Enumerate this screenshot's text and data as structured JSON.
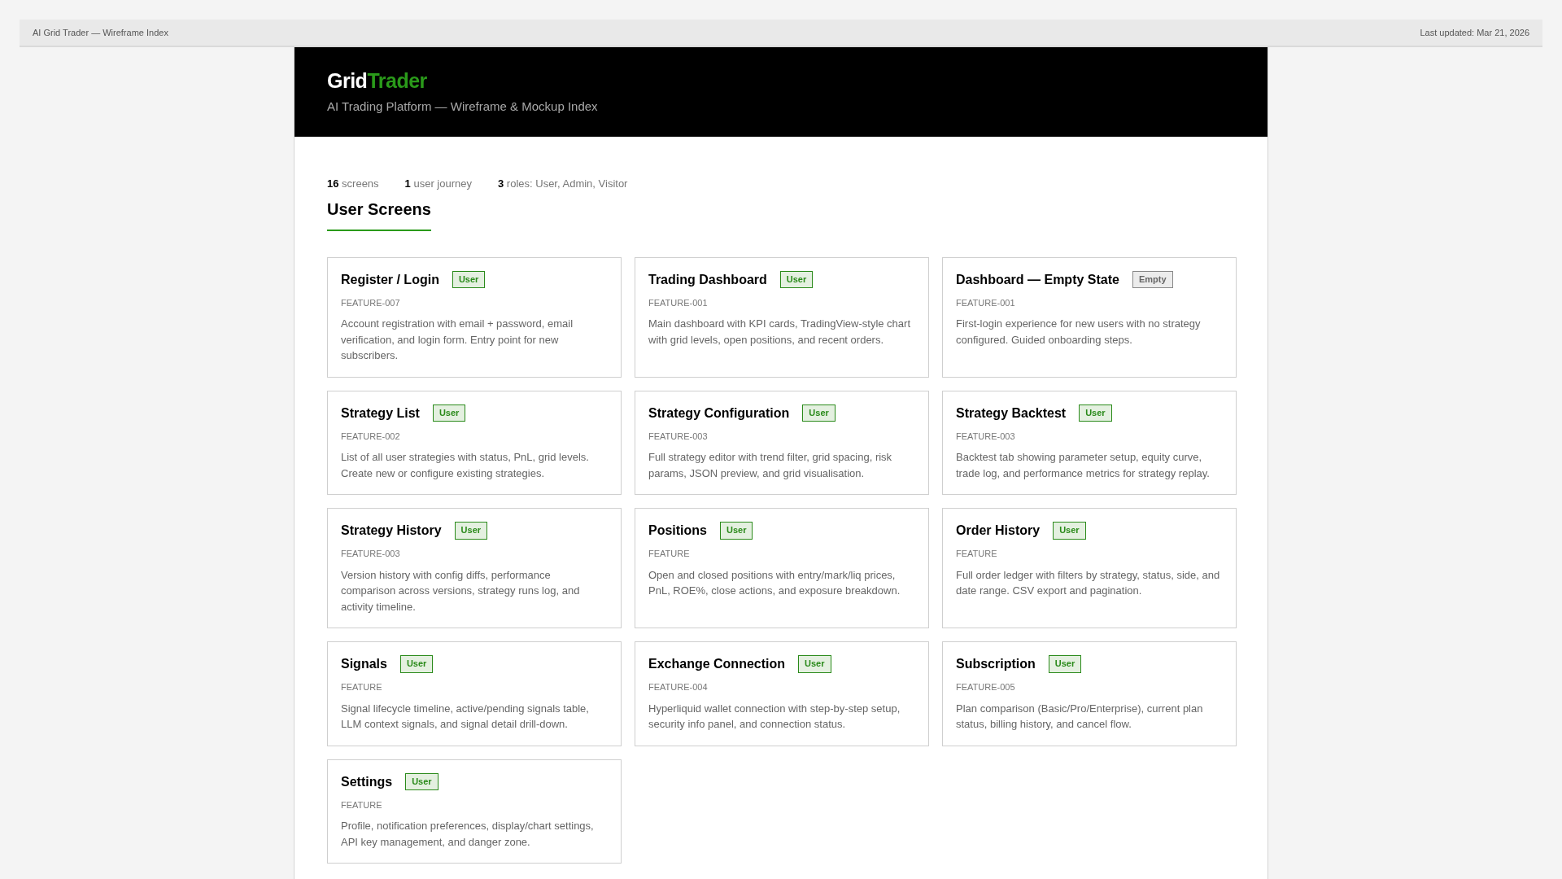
{
  "top_bar": {
    "title": "AI Grid Trader — Wireframe Index",
    "updated": "Last updated: Mar 21, 2026"
  },
  "header": {
    "logo_primary": "Grid",
    "logo_accent": "Trader",
    "subtitle": "AI Trading Platform — Wireframe & Mockup Index"
  },
  "stats": [
    {
      "value": "16",
      "label": "screens"
    },
    {
      "value": "1",
      "label": "user journey"
    },
    {
      "value": "3",
      "label": "roles: User, Admin, Visitor"
    }
  ],
  "section": {
    "title": "User Screens"
  },
  "screens": [
    {
      "title": "Register / Login",
      "badge": {
        "kind": "user",
        "label": "User"
      },
      "feature": "FEATURE-007",
      "description": "Account registration with email + password, email verification, and login form. Entry point for new subscribers."
    },
    {
      "title": "Trading Dashboard",
      "badge": {
        "kind": "user",
        "label": "User"
      },
      "feature": "FEATURE-001",
      "description": "Main dashboard with KPI cards, TradingView-style chart with grid levels, open positions, and recent orders."
    },
    {
      "title": "Dashboard — Empty State",
      "badge": {
        "kind": "empty",
        "label": "Empty"
      },
      "feature": "FEATURE-001",
      "description": "First-login experience for new users with no strategy configured. Guided onboarding steps."
    },
    {
      "title": "Strategy List",
      "badge": {
        "kind": "user",
        "label": "User"
      },
      "feature": "FEATURE-002",
      "description": "List of all user strategies with status, PnL, grid levels. Create new or configure existing strategies."
    },
    {
      "title": "Strategy Configuration",
      "badge": {
        "kind": "user",
        "label": "User"
      },
      "feature": "FEATURE-003",
      "description": "Full strategy editor with trend filter, grid spacing, risk params, JSON preview, and grid visualisation."
    },
    {
      "title": "Strategy Backtest",
      "badge": {
        "kind": "user",
        "label": "User"
      },
      "feature": "FEATURE-003",
      "description": "Backtest tab showing parameter setup, equity curve, trade log, and performance metrics for strategy replay."
    },
    {
      "title": "Strategy History",
      "badge": {
        "kind": "user",
        "label": "User"
      },
      "feature": "FEATURE-003",
      "description": "Version history with config diffs, performance comparison across versions, strategy runs log, and activity timeline."
    },
    {
      "title": "Positions",
      "badge": {
        "kind": "user",
        "label": "User"
      },
      "feature": "FEATURE",
      "description": "Open and closed positions with entry/mark/liq prices, PnL, ROE%, close actions, and exposure breakdown."
    },
    {
      "title": "Order History",
      "badge": {
        "kind": "user",
        "label": "User"
      },
      "feature": "FEATURE",
      "description": "Full order ledger with filters by strategy, status, side, and date range. CSV export and pagination."
    },
    {
      "title": "Signals",
      "badge": {
        "kind": "user",
        "label": "User"
      },
      "feature": "FEATURE",
      "description": "Signal lifecycle timeline, active/pending signals table, LLM context signals, and signal detail drill-down."
    },
    {
      "title": "Exchange Connection",
      "badge": {
        "kind": "user",
        "label": "User"
      },
      "feature": "FEATURE-004",
      "description": "Hyperliquid wallet connection with step-by-step setup, security info panel, and connection status."
    },
    {
      "title": "Subscription",
      "badge": {
        "kind": "user",
        "label": "User"
      },
      "feature": "FEATURE-005",
      "description": "Plan comparison (Basic/Pro/Enterprise), current plan status, billing history, and cancel flow."
    },
    {
      "title": "Settings",
      "badge": {
        "kind": "user",
        "label": "User"
      },
      "feature": "FEATURE",
      "description": "Profile, notification preferences, display/chart settings, API key management, and danger zone."
    }
  ]
}
